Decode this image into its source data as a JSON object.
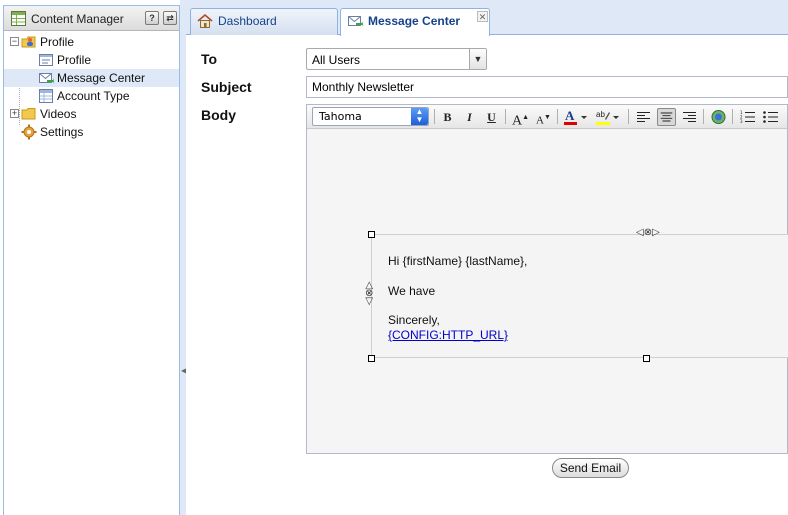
{
  "left_panel": {
    "title": "Content Manager",
    "help_icon": "question-icon",
    "refresh_icon": "refresh-icon",
    "tree": [
      {
        "label": "Profile",
        "icon": "folder-user-icon",
        "expanded": true
      },
      {
        "label": "Profile",
        "icon": "form-icon"
      },
      {
        "label": "Message Center",
        "icon": "mail-send-icon",
        "selected": true
      },
      {
        "label": "Account Type",
        "icon": "table-icon"
      },
      {
        "label": "Videos",
        "icon": "folder-icon",
        "expanded": false
      },
      {
        "label": "Settings",
        "icon": "gear-icon"
      }
    ]
  },
  "tabs": [
    {
      "label": "Dashboard",
      "icon": "home-icon",
      "active": false
    },
    {
      "label": "Message Center",
      "icon": "mail-send-icon",
      "active": true,
      "closable": true
    }
  ],
  "form": {
    "to_label": "To",
    "to_value": "All Users",
    "subject_label": "Subject",
    "subject_value": "Monthly Newsletter",
    "body_label": "Body",
    "font_value": "Tahoma",
    "toolbar": {
      "bold": "B",
      "italic": "I",
      "underline": "U",
      "grow_font": "A",
      "shrink_font": "A"
    },
    "body_lines": {
      "greeting": "Hi {firstName} {lastName},",
      "line2": "We have",
      "closing": "Sincerely,",
      "link": "{CONFIG:HTTP_URL}"
    },
    "send_label": "Send Email"
  },
  "colors": {
    "panel_border": "#99bbe8",
    "tab_bg": "#dfe8f6",
    "selected_row": "#dfe8f6",
    "link": "#0000cc",
    "font_color_bar": "#e00000",
    "highlight_bar": "#ffff00"
  }
}
